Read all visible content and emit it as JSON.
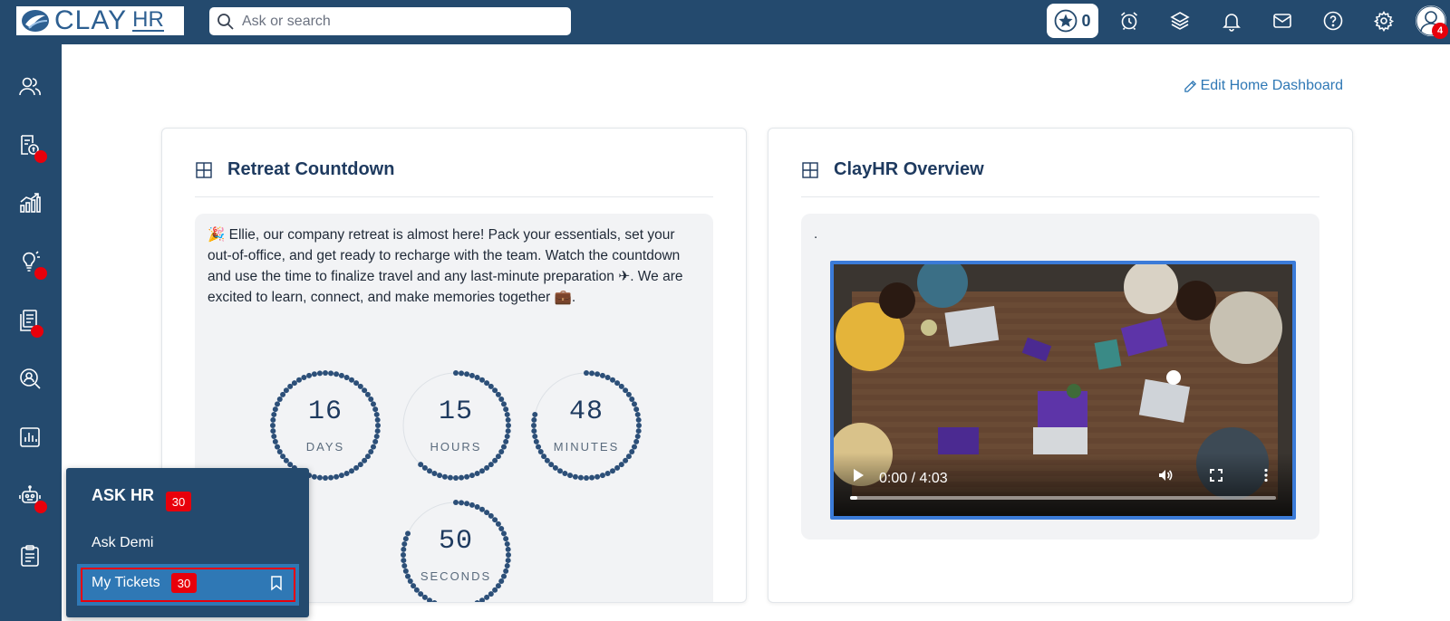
{
  "app": {
    "logo_text": "CLAY",
    "logo_suffix": "HR"
  },
  "header": {
    "search_placeholder": "Ask or search",
    "stars_count": "0",
    "avatar_badge": "4",
    "icons": [
      "star-icon",
      "alarm-clock-icon",
      "layers-icon",
      "bell-icon",
      "mail-icon",
      "help-icon",
      "gear-icon",
      "user-avatar-icon"
    ]
  },
  "sidebar": {
    "items": [
      {
        "icon": "people-icon",
        "dot": false
      },
      {
        "icon": "payroll-icon",
        "dot": true
      },
      {
        "icon": "growth-chart-icon",
        "dot": false
      },
      {
        "icon": "lightbulb-icon",
        "dot": true
      },
      {
        "icon": "documents-icon",
        "dot": true
      },
      {
        "icon": "user-search-icon",
        "dot": false
      },
      {
        "icon": "report-icon",
        "dot": false
      },
      {
        "icon": "robot-icon",
        "dot": true
      },
      {
        "icon": "clipboard-icon",
        "dot": false
      }
    ]
  },
  "dashboard": {
    "edit_link": "Edit Home Dashboard"
  },
  "retreat": {
    "title": "Retreat Countdown",
    "message": "🎉 Ellie, our company retreat is almost here! Pack your essentials, set your out-of-office, and get ready to recharge with the team. Watch the countdown and use the time to finalize travel and any last-minute preparation ✈. We are excited to learn, connect, and make memories together 💼.",
    "timers": [
      {
        "value": "16",
        "label": "DAYS",
        "fraction": 1.0
      },
      {
        "value": "15",
        "label": "HOURS",
        "fraction": 0.625
      },
      {
        "value": "48",
        "label": "MINUTES",
        "fraction": 0.8
      },
      {
        "value": "50",
        "label": "SECONDS",
        "fraction": 0.83
      }
    ]
  },
  "overview": {
    "title": "ClayHR Overview",
    "body_text": ".",
    "video_time": "0:00 / 4:03",
    "video_progress": 0.0
  },
  "ask_hr": {
    "title": "ASK HR",
    "badge": "30",
    "items": [
      {
        "label": "Ask Demi"
      },
      {
        "label": "My Tickets",
        "badge": "30"
      }
    ]
  },
  "colors": {
    "navy": "#244a6e",
    "accent_blue": "#2f78b5",
    "badge_red": "#e8000b",
    "timer_dots": "#2c4f78"
  }
}
